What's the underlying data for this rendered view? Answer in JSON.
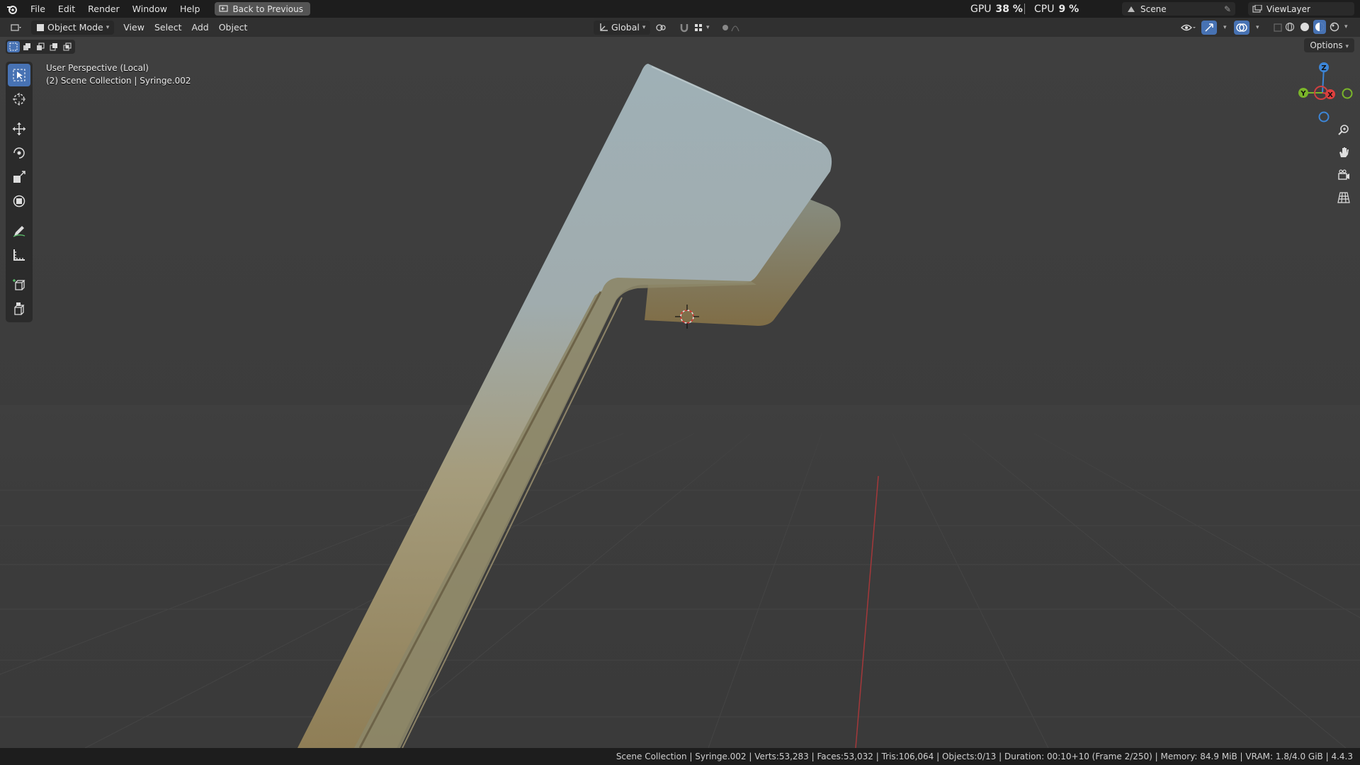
{
  "menu": {
    "items": [
      "File",
      "Edit",
      "Render",
      "Window",
      "Help"
    ],
    "back_label": "Back to Previous"
  },
  "perf": {
    "gpu_label": "GPU",
    "gpu_value": "38 %",
    "cpu_label": "CPU",
    "cpu_value": "9 %"
  },
  "scene": {
    "name": "Scene",
    "view_layer": "ViewLayer"
  },
  "header": {
    "mode": "Object Mode",
    "menus": [
      "View",
      "Select",
      "Add",
      "Object"
    ],
    "orientation": "Global",
    "options": "Options"
  },
  "viewport": {
    "title": "User Perspective (Local)",
    "subtitle": "(2) Scene Collection | Syringe.002"
  },
  "gizmo": {
    "z": "Z",
    "y": "Y",
    "x": "X"
  },
  "status": {
    "text": "Scene Collection | Syringe.002 | Verts:53,283 | Faces:53,032 | Tris:106,064 | Objects:0/13 | Duration: 00:10+10 (Frame 2/250) | Memory: 84.9 MiB | VRAM: 1.8/4.0 GiB | 4.4.3"
  },
  "colors": {
    "accent": "#4772b3",
    "x_axis": "#e0403e",
    "y_axis": "#7ab52a",
    "z_axis": "#3d86d8"
  }
}
